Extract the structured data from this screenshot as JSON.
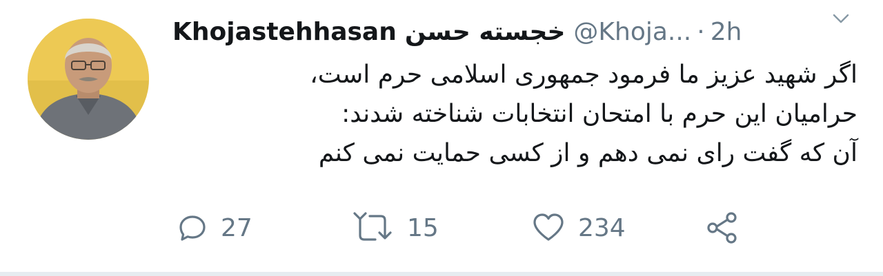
{
  "tweet": {
    "display_name": "Khojastehhasan",
    "display_name_fa": "خجسته حسن",
    "handle": "@Khoja...",
    "separator": "·",
    "time": "2h",
    "lines": [
      "اگر شهید عزیز ما فرمود جمهوری اسلامی حرم است،",
      "حرامیان این حرم با امتحان انتخابات شناخته شدند:",
      "آن که گفت رای نمی دهم و از کسی حمایت نمی کنم"
    ]
  },
  "actions": {
    "reply_count": "27",
    "retweet_count": "15",
    "like_count": "234"
  },
  "icons": {
    "reply": "reply-icon",
    "retweet": "retweet-icon",
    "like": "heart-icon",
    "share": "share-icon",
    "more": "chevron-down-icon"
  },
  "colors": {
    "text": "#14171a",
    "secondary": "#657786",
    "divider": "#e6ecf0"
  }
}
